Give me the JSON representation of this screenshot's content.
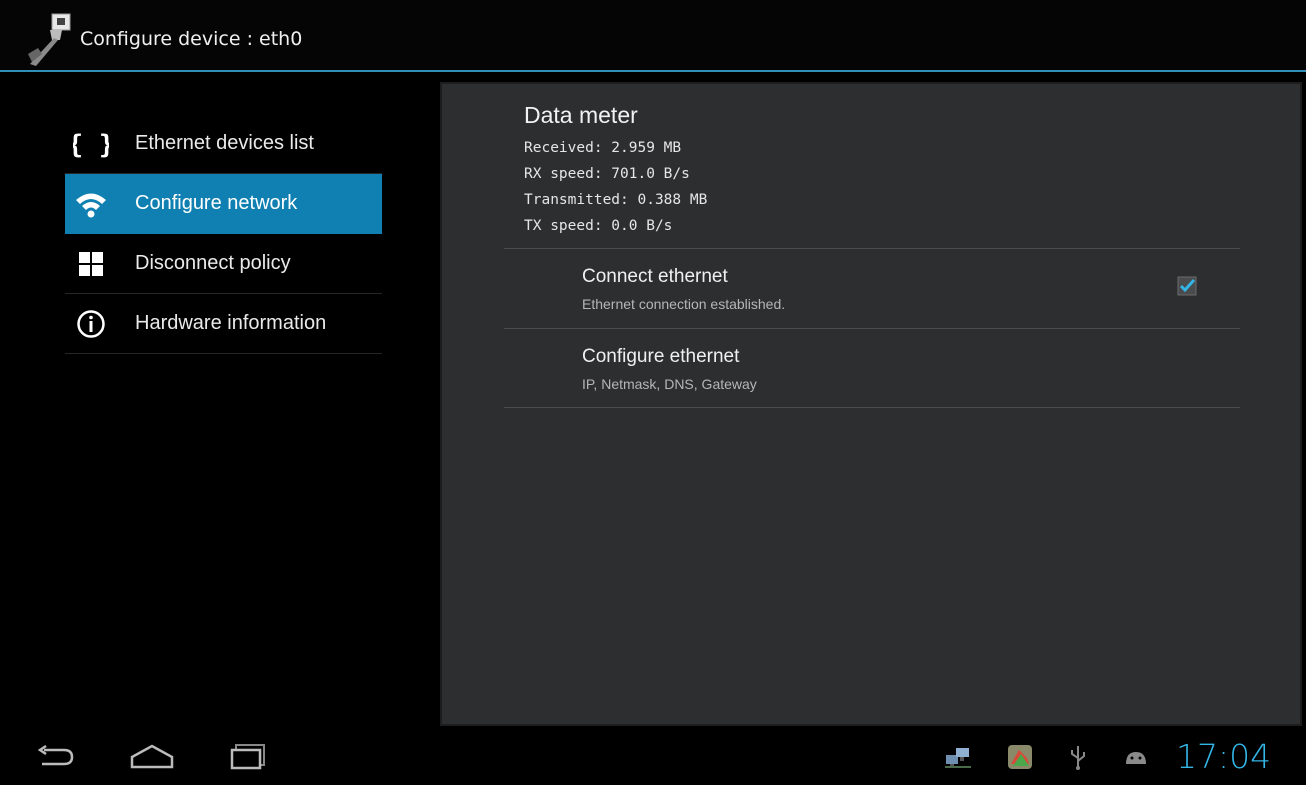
{
  "actionbar": {
    "title": "Configure device : eth0",
    "icon": "ethernet-plug-icon"
  },
  "nav": {
    "items": [
      {
        "label": "Ethernet devices list",
        "icon": "braces-icon",
        "active": false
      },
      {
        "label": "Configure network",
        "icon": "wifi-icon",
        "active": true
      },
      {
        "label": "Disconnect policy",
        "icon": "grid-icon",
        "active": false
      },
      {
        "label": "Hardware information",
        "icon": "info-icon",
        "active": false
      }
    ]
  },
  "data_meter": {
    "title": "Data meter",
    "received": "Received: 2.959 MB",
    "rx_speed": "RX speed: 701.0 B/s",
    "transmitted": "Transmitted: 0.388 MB",
    "tx_speed": "TX speed: 0.0 B/s"
  },
  "prefs": {
    "connect": {
      "title": "Connect ethernet",
      "summary": "Ethernet connection established.",
      "checked": true
    },
    "configure": {
      "title": "Configure ethernet",
      "summary": "IP, Netmask, DNS, Gateway"
    }
  },
  "statusbar": {
    "time": "17:04",
    "icons": [
      "network-icon",
      "app-notification-icon",
      "usb-icon",
      "android-debug-icon",
      "battery-icon"
    ]
  },
  "colors": {
    "accent": "#33b5e5",
    "selected": "#0f80b1",
    "panel": "#2d2e30"
  }
}
